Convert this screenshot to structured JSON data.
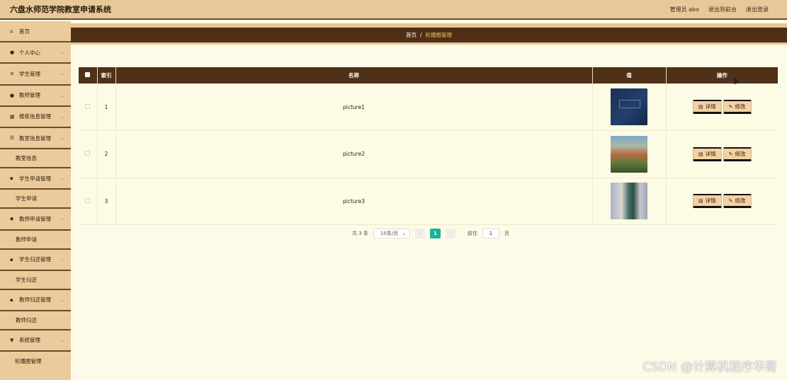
{
  "header": {
    "title": "六盘水师范学院教室申请系统",
    "links": [
      "管理员 abo",
      "退出到前台",
      "退出登录"
    ]
  },
  "sidebar": {
    "items": [
      {
        "type": "item",
        "label": "首页",
        "icon": "home-icon",
        "glyph": "⌂",
        "has_chevron": false
      },
      {
        "type": "item",
        "label": "个人中心",
        "icon": "user-icon",
        "glyph": "●",
        "has_chevron": true
      },
      {
        "type": "item",
        "label": "学生管理",
        "icon": "list-icon",
        "glyph": "≡",
        "has_chevron": true
      },
      {
        "type": "item",
        "label": "教师管理",
        "icon": "user-icon",
        "glyph": "●",
        "has_chevron": true
      },
      {
        "type": "item",
        "label": "楼栋信息管理",
        "icon": "building-icon",
        "glyph": "▦",
        "has_chevron": true
      },
      {
        "type": "item",
        "label": "教室信息管理",
        "icon": "sliders-icon",
        "glyph": "☰",
        "has_chevron": true
      },
      {
        "type": "sub",
        "label": "教室信息"
      },
      {
        "type": "item",
        "label": "学生申请管理",
        "icon": "grid-icon",
        "glyph": "▪",
        "has_chevron": true
      },
      {
        "type": "sub",
        "label": "学生申请"
      },
      {
        "type": "item",
        "label": "教师申请管理",
        "icon": "bell-icon",
        "glyph": "◆",
        "has_chevron": true
      },
      {
        "type": "sub",
        "label": "教师申请"
      },
      {
        "type": "item",
        "label": "学生归还管理",
        "icon": "grid-icon",
        "glyph": "▪",
        "has_chevron": true
      },
      {
        "type": "sub",
        "label": "学生归还"
      },
      {
        "type": "item",
        "label": "教师归还管理",
        "icon": "grid-icon",
        "glyph": "▪",
        "has_chevron": true
      },
      {
        "type": "sub",
        "label": "教师归还"
      },
      {
        "type": "item",
        "label": "系统管理",
        "icon": "shield-icon",
        "glyph": "▼",
        "has_chevron": true
      },
      {
        "type": "sub-last",
        "label": "轮播图管理"
      }
    ]
  },
  "breadcrumb": {
    "home": "首页",
    "separator": "/",
    "current": "轮播图管理"
  },
  "table": {
    "columns": [
      "索引",
      "名称",
      "值",
      "操作"
    ],
    "rows": [
      {
        "index": "1",
        "name": "picture1",
        "image": "thumb1"
      },
      {
        "index": "2",
        "name": "picture2",
        "image": "thumb2"
      },
      {
        "index": "3",
        "name": "picture3",
        "image": "thumb3"
      }
    ],
    "detail_label": "详情",
    "edit_label": "修改"
  },
  "pagination": {
    "total": "共 3 条",
    "page_size": "10条/页",
    "current_page": "1",
    "goto_label": "前往",
    "goto_value": "1",
    "page_suffix": "页"
  },
  "watermark": "CSDN @计算机程序华哥",
  "colors": {
    "header_bg": "#e8c898",
    "sidebar_bg": "#ebcb9b",
    "dark_brown": "#4f3117",
    "page_bg": "#fdfbe8",
    "active_page": "#1bb394"
  }
}
